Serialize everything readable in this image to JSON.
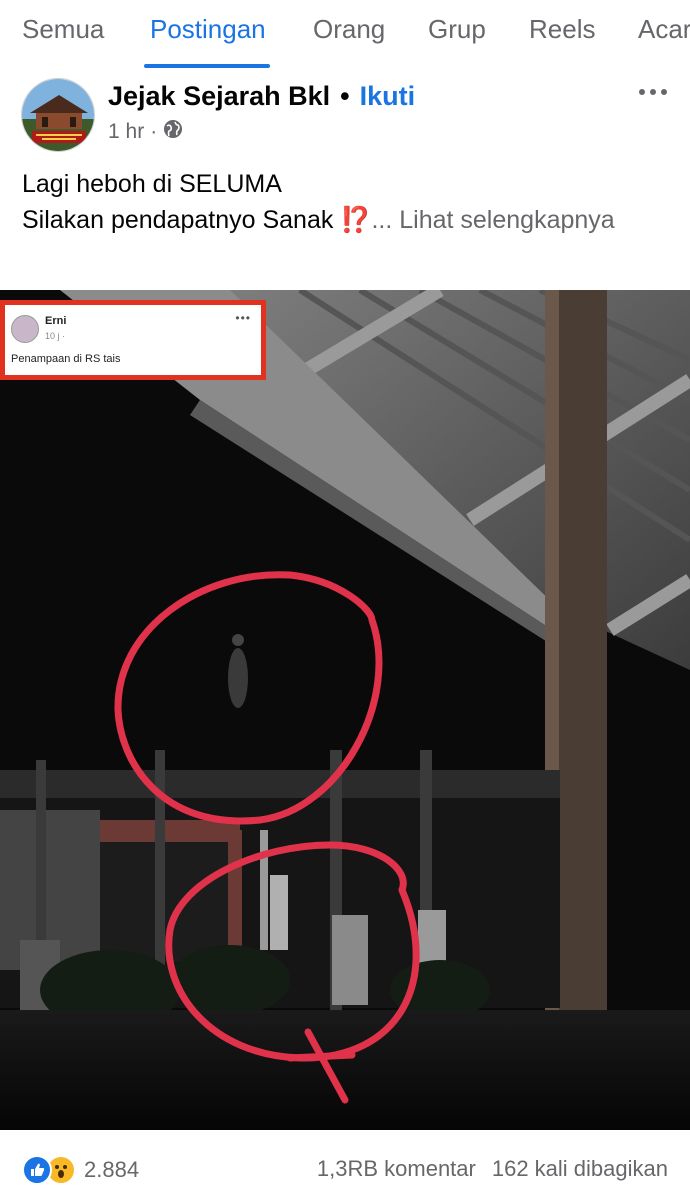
{
  "tabs": [
    {
      "label": "Semua",
      "active": false
    },
    {
      "label": "Postingan",
      "active": true
    },
    {
      "label": "Orang",
      "active": false
    },
    {
      "label": "Grup",
      "active": false
    },
    {
      "label": "Reels",
      "active": false
    },
    {
      "label": "Acar",
      "active": false
    }
  ],
  "post": {
    "author": "Jejak Sejarah Bkl",
    "separator": "•",
    "follow_label": "Ikuti",
    "time": "1 hr",
    "separator_meta": "·",
    "privacy_icon": "globe-icon",
    "text_line1": "Lagi heboh di SELUMA",
    "text_line2": "Silakan pendapatnyo Sanak",
    "emoji": "⁉️",
    "see_more": "... Lihat selengkapnya"
  },
  "inset": {
    "name": "Erni",
    "meta": "10 j · ",
    "text": "Penampaan di RS tais",
    "dots": "•••"
  },
  "footer": {
    "reactions": [
      "like-icon",
      "wow-icon"
    ],
    "reaction_count": "2.884",
    "comments": "1,3RB komentar",
    "shares": "162 kali dibagikan"
  },
  "colors": {
    "accent": "#1b74e4",
    "secondary_text": "#65676b",
    "annotation_red": "#e0324a"
  }
}
